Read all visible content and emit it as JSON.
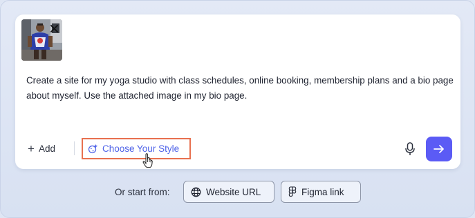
{
  "composer": {
    "prompt_text": "Create a site for my yoga studio with class schedules, online booking, membership plans and a bio page about myself. Use the attached image in my bio page.",
    "attachment": {
      "close_icon": "close-icon"
    },
    "toolbar": {
      "add_label": "Add",
      "add_icon": "plus-icon",
      "style_label": "Choose Your Style",
      "style_icon": "palette-sparkle-icon",
      "mic_icon": "microphone-icon",
      "send_icon": "arrow-right-icon"
    }
  },
  "start_from": {
    "label": "Or start from:",
    "options": [
      {
        "label": "Website URL",
        "icon": "globe-icon"
      },
      {
        "label": "Figma link",
        "icon": "figma-icon"
      }
    ]
  },
  "colors": {
    "accent": "#5b5bf5",
    "style_link": "#4f63e8",
    "highlight_border": "#e8704f",
    "background": "#dfe6f4"
  }
}
